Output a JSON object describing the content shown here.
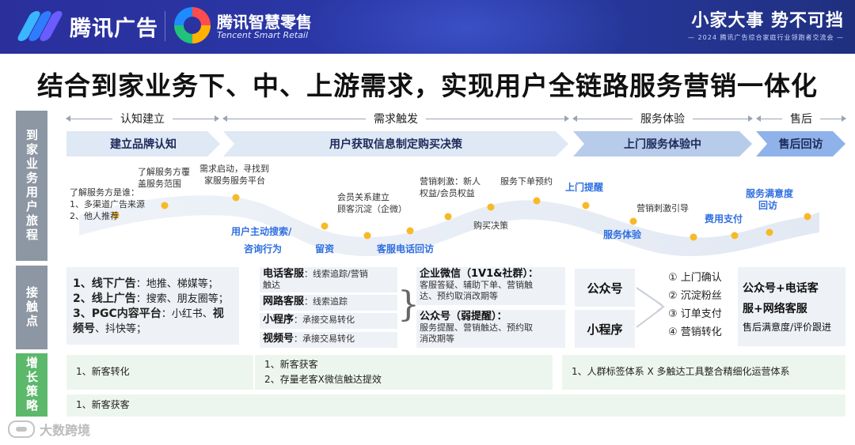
{
  "header": {
    "brand1": "腾讯广告",
    "brand2": "腾讯智慧零售",
    "brand2_en": "Tencent Smart Retail",
    "slogan": "小家大事  势不可挡",
    "slogan_sub": "— 2024 腾讯广告综合家庭行业领跑者交流会 —"
  },
  "title": "结合到家业务下、中、上游需求，实现用户全链路服务营销一体化",
  "rows": {
    "journey": "到家业务用户旅程",
    "touch": "接触点",
    "growth": "增长策略"
  },
  "stages": [
    {
      "label": "认知建立",
      "banner": "建立品牌认知"
    },
    {
      "label": "需求触发",
      "banner": "用户获取信息制定购买决策"
    },
    {
      "label": "服务体验",
      "banner": "上门服务体验中"
    },
    {
      "label": "售后",
      "banner": "售后回访"
    }
  ],
  "journey": {
    "t1": "了解服务方是谁：",
    "t1b": "1、多渠道广告来源",
    "t1c": "2、他人推荐",
    "t2": "了解服务方覆",
    "t2b": "盖服务范围",
    "t3": "需求启动，寻找到",
    "t3b": "家服务服务平台",
    "t4": "会员关系建立",
    "t4b": "顾客沉淀（企微）",
    "t5": "营销刺激：新人",
    "t5b": "权益/会员权益",
    "t6": "服务下单预约",
    "t7": "购买决策",
    "t8": "上门提醒",
    "t9": "营销刺激引导",
    "t10": "服务满意度",
    "t10b": "回访",
    "h1": "用户主动搜索/",
    "h1b": "咨询行为",
    "h2": "留资",
    "h3": "客服电话回访",
    "h4": "服务体验",
    "h5": "费用支付"
  },
  "touch": {
    "offline_title": "1、线下广告",
    "offline_items": "：地推、梯媒等；",
    "online_title": "2、线上广告",
    "online_items": "：搜索、朋友圈等；",
    "pgc_title": "3、PGC内容平台",
    "pgc_items": "：小红书、",
    "pgc_items_b": "视",
    "pgc_items_c": "频号",
    "pgc_items_d": "、抖快等；",
    "phone_title": "电话客服",
    "phone_desc": "：线索追踪/营销",
    "phone_desc_b": "触达",
    "web_title": "网路客服",
    "web_desc": "：线索追踪",
    "mini_title": "小程序",
    "mini_desc": "：承接交易转化",
    "video_title": "视频号",
    "video_desc": "：承接交易转化",
    "wecom_title": "企业微信（1V1&社群）：",
    "wecom_desc": "客服答疑、辅助下单、营销触",
    "wecom_desc_b": "达、预约取消改期等",
    "oa_title": "公众号（弱提醒）：",
    "oa_desc": "服务提醒、营销触达、预约取",
    "oa_desc_b": "消改期等",
    "box_oa": "公众号",
    "box_mini": "小程序",
    "list": [
      "① 上门确认",
      "② 沉淀粉丝",
      "③ 订单支付",
      "④ 营销转化"
    ],
    "after_title": "公众号+电话客",
    "after_title_b": "服+网络客服",
    "after_desc": "售后满意度/评价跟进"
  },
  "growth": {
    "g1": "1、新客转化",
    "g2a": "1、新客获客",
    "g2b": "2、存量老客X微信触达提效",
    "g3": "1、人群标签体系 X 多触达工具整合精细化运营体系",
    "g4": "1、新客获客"
  },
  "watermark": "大数跨境"
}
